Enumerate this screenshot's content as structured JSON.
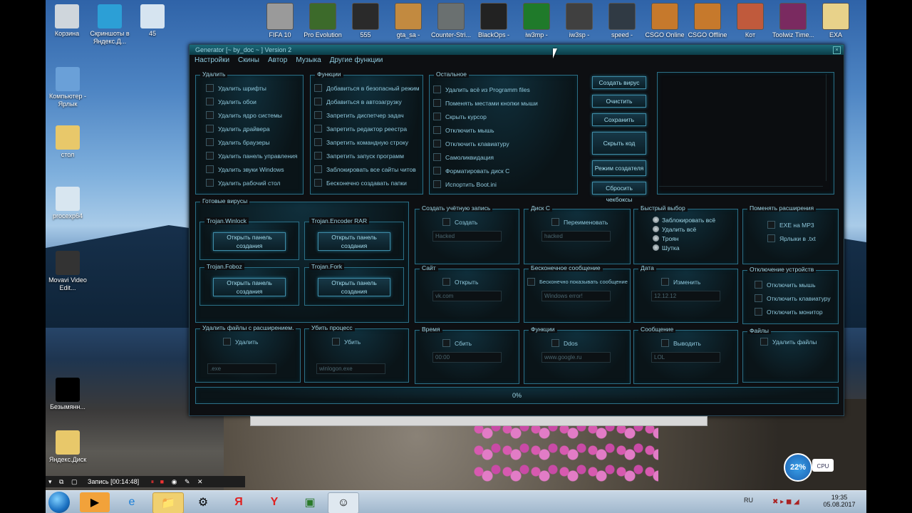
{
  "desktop_top_icons": [
    {
      "label": "Корзина",
      "color": "#cfd6dc"
    },
    {
      "label": "Скриншоты в Яндекс.Д...",
      "color": "#2c9fd6"
    },
    {
      "label": "45",
      "color": "#d6e4f0"
    }
  ],
  "taskbar_icons": [
    {
      "label": "FIFA 10",
      "color": "#9a9a9a"
    },
    {
      "label": "Pro Evolution",
      "color": "#3c6a2a"
    },
    {
      "label": "555",
      "color": "#2a2a2a"
    },
    {
      "label": "gta_sa -",
      "color": "#c28a40"
    },
    {
      "label": "Counter-Stri...",
      "color": "#6a7070"
    },
    {
      "label": "BlackOps -",
      "color": "#222"
    },
    {
      "label": "iw3mp -",
      "color": "#1f7a2a"
    },
    {
      "label": "iw3sp -",
      "color": "#404040"
    },
    {
      "label": "speed -",
      "color": "#303a44"
    },
    {
      "label": "CSGO Online",
      "color": "#c6792c"
    },
    {
      "label": "CSGO Offline",
      "color": "#c6792c"
    },
    {
      "label": "Кот",
      "color": "#c05a3c"
    },
    {
      "label": "Toolwiz Time...",
      "color": "#7a2a60"
    },
    {
      "label": "ЕХА",
      "color": "#e8d28a"
    }
  ],
  "desktop_left_icons": [
    {
      "label": "Компьютер - Ярлык",
      "color": "#6aa0d8"
    },
    {
      "label": "стол",
      "color": "#e8c86a"
    },
    {
      "label": "procexp64",
      "color": "#d8e6f0"
    },
    {
      "label": "Movavi Video Edit...",
      "color": "#333"
    },
    {
      "label": "Безымянн...",
      "color": "#000"
    },
    {
      "label": "Яндекс.Диск",
      "color": "#e8c86a"
    }
  ],
  "app": {
    "title": "Generator [~ by_doc ~ ] Version 2",
    "menu": [
      "Настройки",
      "Скины",
      "Автор",
      "Музыка",
      "Другие функции"
    ],
    "udalit": {
      "title": "Удалить",
      "items": [
        "Удалить шрифты",
        "Удалить обои",
        "Удалить ядро системы",
        "Удалить драйвера",
        "Удалить браузеры",
        "Удалить панель управления",
        "Удалить звуки Windows",
        "Удалить рабочий стол"
      ]
    },
    "funkcii": {
      "title": "Функции",
      "items": [
        "Добавиться в безопасный режим",
        "Добавиться в автозагрузку",
        "Запретить диспетчер задач",
        "Запретить редактор реестра",
        "Запретить командную строку",
        "Запретить запуск программ",
        "Заблокировать все сайты читов",
        "Бесконечно создавать папки"
      ]
    },
    "ostalnoe": {
      "title": "Остальное",
      "items": [
        "Удалить всё из Programm files",
        "Поменять местами кнопки мыши",
        "Скрыть курсор",
        "Отключить мышь",
        "Отключить клавиатуру",
        "Самоликвидация",
        "Форматировать диск C",
        "Испортить Boot.ini"
      ]
    },
    "side_buttons": [
      "Создать вирус",
      "Очистить",
      "Сохранить",
      "Скрыть код",
      "Режим создателя",
      "Сбросить чекбоксы"
    ],
    "gotovye": {
      "title": "Готовые вирусы",
      "items": [
        {
          "name": "Trojan.Winlock",
          "btn": "Открыть панель создания"
        },
        {
          "name": "Trojan.Encoder RAR",
          "btn": "Открыть панель создания"
        },
        {
          "name": "Trojan.Foboz",
          "btn": "Открыть панель создания"
        },
        {
          "name": "Trojan.Fork",
          "btn": "Открыть панель создания"
        }
      ]
    },
    "uchetka": {
      "title": "Создать учётную запись",
      "check": "Создать",
      "value": "Hacked"
    },
    "disk": {
      "title": "Диск C",
      "check": "Переименовать",
      "value": "hacked"
    },
    "bystryi": {
      "title": "Быстрый выбор",
      "options": [
        "Заблокировать всё",
        "Удалить всё",
        "Троян",
        "Шутка"
      ]
    },
    "rasshirenia": {
      "title": "Поменять расширения",
      "items": [
        "EXE на MP3",
        "Ярлыки в .txt"
      ]
    },
    "sait": {
      "title": "Сайт",
      "check": "Открыть",
      "value": "vk.com"
    },
    "soobshenie": {
      "title": "Бесконечное сообщение",
      "check": "Бесконечно показывать сообщение",
      "value": "Windows error!"
    },
    "data": {
      "title": "Дата",
      "check": "Изменить",
      "value": "12.12.12"
    },
    "otkl": {
      "title": "Отключение устройств",
      "items": [
        "Отключить мышь",
        "Отключить клавиатуру",
        "Отключить монитор"
      ]
    },
    "udalit_ext": {
      "title": "Удалить файлы с расширением.",
      "check": "Удалить",
      "value": ".exe"
    },
    "ubit": {
      "title": "Убить процесс",
      "check": "Убить",
      "value": "winlogon.exe"
    },
    "vremya": {
      "title": "Время",
      "check": "Сбить",
      "value": "00:00"
    },
    "funkcii2": {
      "title": "Функции",
      "check": "Ddos",
      "value": "www.google.ru"
    },
    "soob2": {
      "title": "Сообщение",
      "check": "Выводить",
      "value": "LOL"
    },
    "faily": {
      "title": "Файлы",
      "check": "Удалить файлы"
    },
    "progress": "0%"
  },
  "recbar": {
    "text": "Запись [00:14:48]"
  },
  "cpu": {
    "value": "22%",
    "label": "CPU"
  },
  "tray": {
    "lang": "RU",
    "time": "19:35",
    "date": "05.08.2017"
  }
}
